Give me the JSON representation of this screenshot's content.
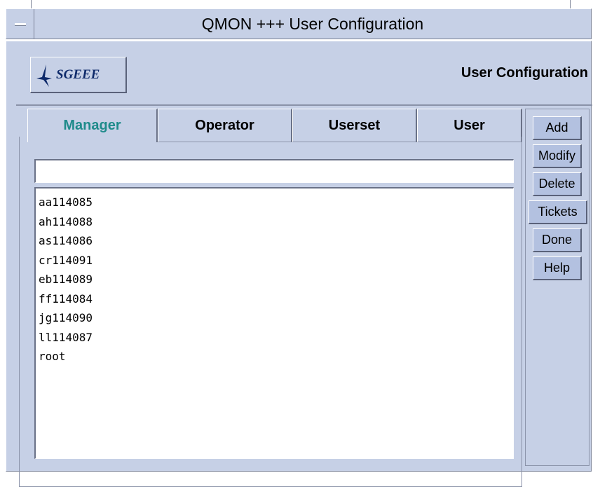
{
  "window": {
    "title": "QMON  +++  User Configuration"
  },
  "header": {
    "logo_text": "SGEEE",
    "title": "User Configuration"
  },
  "tabs": [
    {
      "label": "Manager",
      "active": true
    },
    {
      "label": "Operator",
      "active": false
    },
    {
      "label": "Userset",
      "active": false
    },
    {
      "label": "User",
      "active": false
    }
  ],
  "search": {
    "value": ""
  },
  "list": {
    "items": [
      "aa114085",
      "ah114088",
      "as114086",
      "cr114091",
      "eb114089",
      "ff114084",
      "jg114090",
      "ll114087",
      "root"
    ]
  },
  "buttons": {
    "add": "Add",
    "modify": "Modify",
    "delete": "Delete",
    "tickets": "Tickets",
    "done": "Done",
    "help": "Help"
  },
  "colors": {
    "background": "#c6d0e6",
    "active_tab_text": "#1f8b8b",
    "button": "#b3c1e0",
    "logo_text": "#0e2a6a"
  }
}
